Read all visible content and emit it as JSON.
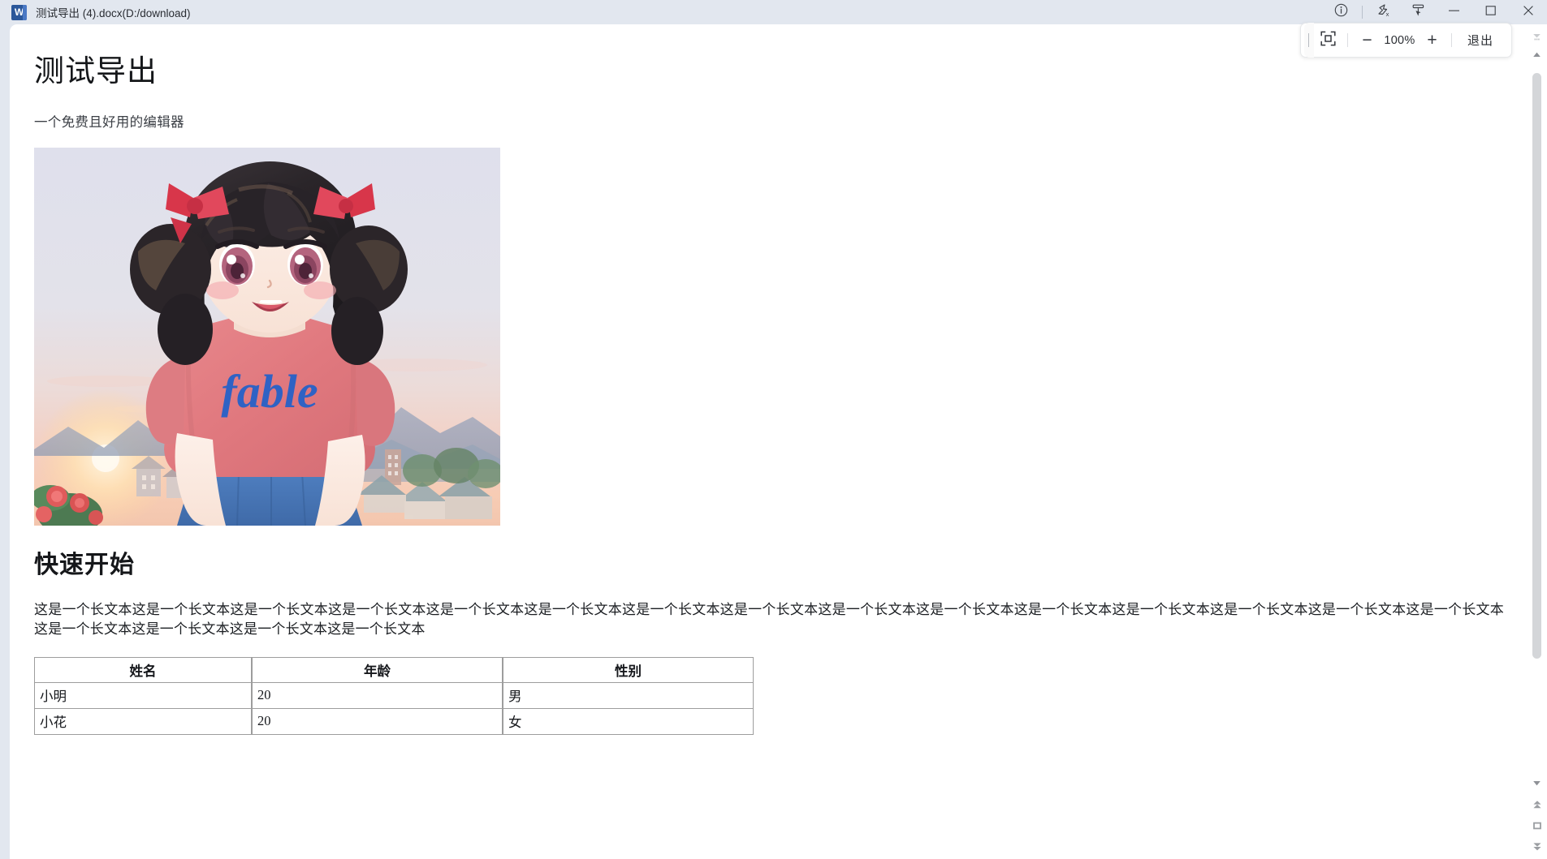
{
  "window": {
    "title": "测试导出 (4).docx(D:/download)",
    "app_icon_letter": "W",
    "controls": [
      {
        "name": "info-icon",
        "label": "信息"
      },
      {
        "name": "ink-off-icon",
        "label": "墨迹关闭"
      },
      {
        "name": "select-tool-icon",
        "label": "选择工具"
      },
      {
        "name": "minimize-icon",
        "label": "最小化"
      },
      {
        "name": "maximize-icon",
        "label": "最大化"
      },
      {
        "name": "close-icon",
        "label": "关闭"
      }
    ]
  },
  "zoom_toolbar": {
    "fit_icon": "fit-to-screen-icon",
    "zoom_out_label": "−",
    "zoom_level": "100%",
    "zoom_in_label": "+",
    "exit_label": "退出"
  },
  "document": {
    "title": "测试导出",
    "subtitle": "一个免费且好用的编辑器",
    "figure": {
      "name": "anime-girl-sunset-illustration",
      "alt": "动漫女孩日落插图",
      "shirt_text": "fable"
    },
    "heading2": "快速开始",
    "paragraph": "这是一个长文本这是一个长文本这是一个长文本这是一个长文本这是一个长文本这是一个长文本这是一个长文本这是一个长文本这是一个长文本这是一个长文本这是一个长文本这是一个长文本这是一个长文本这是一个长文本这是一个长文本这是一个长文本这是一个长文本这是一个长文本这是一个长文本",
    "table": {
      "headers": [
        "姓名",
        "年龄",
        "性别"
      ],
      "rows": [
        [
          "小明",
          "20",
          "男"
        ],
        [
          "小花",
          "20",
          "女"
        ]
      ]
    }
  },
  "scrollbar": {
    "top_icons": [
      "collapse-up-icon",
      "scroll-up-arrow-icon"
    ],
    "bottom_icons": [
      "scroll-down-arrow-icon",
      "page-up-icon",
      "page-box-icon",
      "page-down-icon"
    ]
  },
  "colors": {
    "titlebar_bg": "#e2e7ef",
    "sheet_bg": "#ffffff",
    "word_blue": "#2b579a",
    "text_primary": "#15171a",
    "table_border": "#9d9d9d",
    "scroll_thumb": "#d4d6d9"
  }
}
